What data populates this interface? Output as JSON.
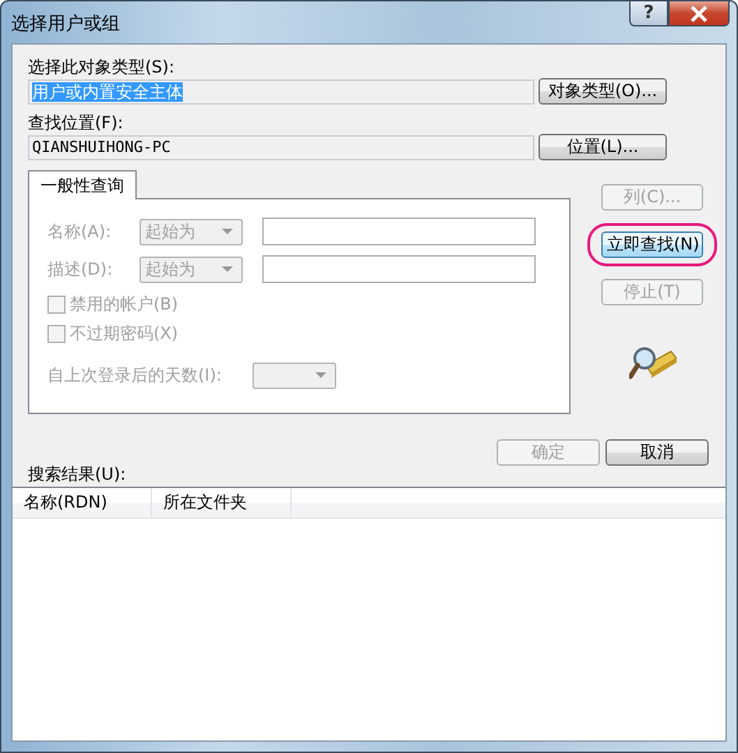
{
  "window": {
    "title": "选择用户或组",
    "help_button": "?"
  },
  "object_type": {
    "label": "选择此对象类型(S):",
    "value": "用户或内置安全主体",
    "selected": true,
    "button": "对象类型(O)..."
  },
  "location": {
    "label": "查找位置(F):",
    "value": "QIANSHUIHONG-PC",
    "button": "位置(L)..."
  },
  "tabs": [
    {
      "label": "一般性查询",
      "selected": true
    }
  ],
  "query_rows": [
    {
      "label": "名称(A):",
      "match": "起始为",
      "disabled": true
    },
    {
      "label": "描述(D):",
      "match": "起始为",
      "disabled": true
    }
  ],
  "checkboxes": [
    {
      "label": "禁用的帐户(B)",
      "checked": false,
      "disabled": true
    },
    {
      "label": "不过期密码(X)",
      "checked": false,
      "disabled": true
    }
  ],
  "days_since_logon": {
    "label": "自上次登录后的天数(I):",
    "disabled": true
  },
  "side_buttons": [
    {
      "label": "列(C)...",
      "disabled": true,
      "highlighted": false
    },
    {
      "label": "立即查找(N)",
      "disabled": false,
      "highlighted": true
    },
    {
      "label": "停止(T)",
      "disabled": true,
      "highlighted": false
    }
  ],
  "dialog_buttons": [
    {
      "label": "确定",
      "disabled": true
    },
    {
      "label": "取消",
      "disabled": false
    }
  ],
  "results": {
    "label": "搜索结果(U):",
    "columns": [
      "名称(RDN)",
      "所在文件夹"
    ]
  }
}
